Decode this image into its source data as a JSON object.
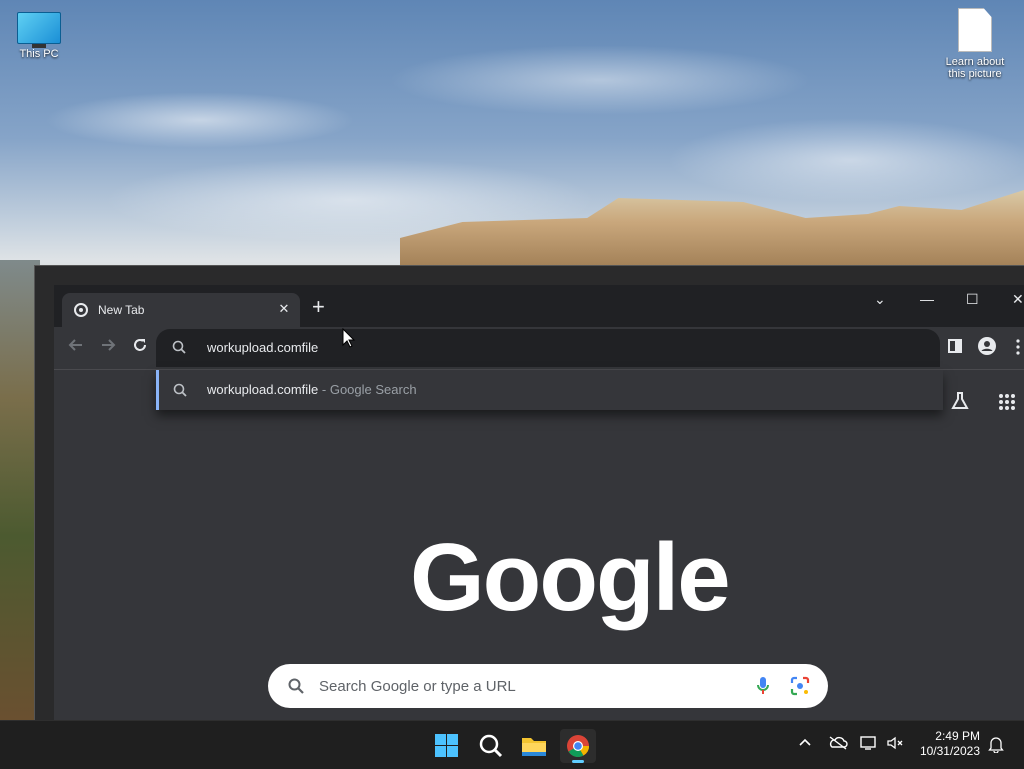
{
  "desktop": {
    "icons": [
      {
        "label": "This PC"
      },
      {
        "label": "Learn about this picture"
      }
    ]
  },
  "browser": {
    "tab_title": "New Tab",
    "tab_close": "✕",
    "new_tab": "+",
    "window_controls": {
      "tab_search": "⌄",
      "minimize": "—",
      "maximize": "☐",
      "close": "✕"
    },
    "omnibox_text": "workupload.comfile",
    "suggestion": {
      "text": "workupload.comfile",
      "suffix": " - Google Search"
    },
    "logo": "Google",
    "search_placeholder": "Search Google or type a URL"
  },
  "taskbar": {
    "time": "2:49 PM",
    "date": "10/31/2023"
  },
  "colors": {
    "accent": "#8ab4f8",
    "taskbar_indicator": "#60cdff"
  }
}
